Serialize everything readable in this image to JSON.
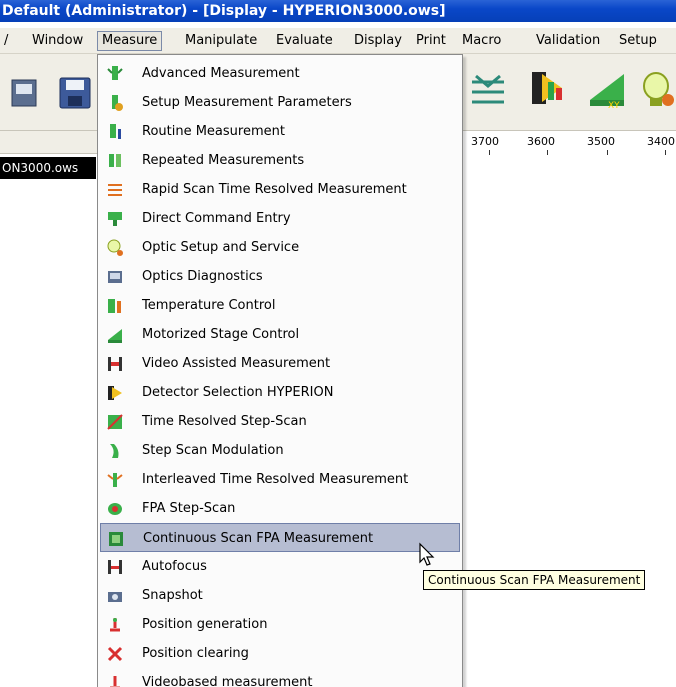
{
  "window": {
    "title": "Default  (Administrator) - [Display - HYPERION3000.ows]"
  },
  "menubar": {
    "items": [
      {
        "label": "Window",
        "ul": "W"
      },
      {
        "label": "Measure",
        "ul": "M"
      },
      {
        "label": "Manipulate",
        "ul": "a"
      },
      {
        "label": "Evaluate",
        "ul": "u"
      },
      {
        "label": "Display",
        "ul": "D"
      },
      {
        "label": "Print",
        "ul": "P"
      },
      {
        "label": "Macro",
        "ul": "o"
      },
      {
        "label": "Validation",
        "ul": "l"
      },
      {
        "label": "Setup",
        "ul": "S"
      }
    ],
    "left_fragment": "/"
  },
  "axis": {
    "ticks": [
      "3700",
      "3600",
      "3500",
      "3400"
    ]
  },
  "left_panel": {
    "file_label": "ON3000.ows"
  },
  "measure_menu": {
    "items": [
      {
        "label": "Advanced Measurement",
        "icon": "advanced-measurement-icon"
      },
      {
        "label": "Setup Measurement Parameters",
        "icon": "setup-parameters-icon"
      },
      {
        "label": "Routine Measurement",
        "icon": "routine-measurement-icon"
      },
      {
        "label": "Repeated Measurements",
        "icon": "repeated-measurements-icon"
      },
      {
        "label": "Rapid Scan Time Resolved Measurement",
        "icon": "rapid-scan-icon"
      },
      {
        "label": "Direct Command Entry",
        "icon": "direct-command-icon"
      },
      {
        "label": "Optic Setup and Service",
        "icon": "optic-setup-icon"
      },
      {
        "label": "Optics Diagnostics",
        "icon": "optics-diagnostics-icon"
      },
      {
        "label": "Temperature Control",
        "icon": "temperature-control-icon"
      },
      {
        "label": "Motorized Stage Control",
        "icon": "stage-control-icon"
      },
      {
        "label": "Video Assisted Measurement",
        "icon": "video-measurement-icon"
      },
      {
        "label": "Detector Selection HYPERION",
        "icon": "detector-selection-icon"
      },
      {
        "label": "Time Resolved Step-Scan",
        "icon": "time-resolved-stepscan-icon"
      },
      {
        "label": "Step Scan Modulation",
        "icon": "step-scan-modulation-icon"
      },
      {
        "label": "Interleaved Time Resolved Measurement",
        "icon": "interleaved-measurement-icon"
      },
      {
        "label": "FPA Step-Scan",
        "icon": "fpa-stepscan-icon"
      },
      {
        "label": "Continuous Scan FPA Measurement",
        "icon": "continuous-fpa-icon"
      },
      {
        "label": "Autofocus",
        "icon": "autofocus-icon"
      },
      {
        "label": "Snapshot",
        "icon": "snapshot-icon"
      },
      {
        "label": "Position generation",
        "icon": "position-generation-icon"
      },
      {
        "label": "Position clearing",
        "icon": "position-clearing-icon"
      },
      {
        "label": "Videobased measurement",
        "icon": "videobased-measurement-icon"
      }
    ],
    "highlighted_index": 16
  },
  "tooltip": {
    "text": "Continuous Scan FPA Measurement"
  },
  "colors": {
    "titlebar": "#0a47c8",
    "highlight": "#b6bdd2",
    "tooltip_bg": "#ffffe1"
  }
}
